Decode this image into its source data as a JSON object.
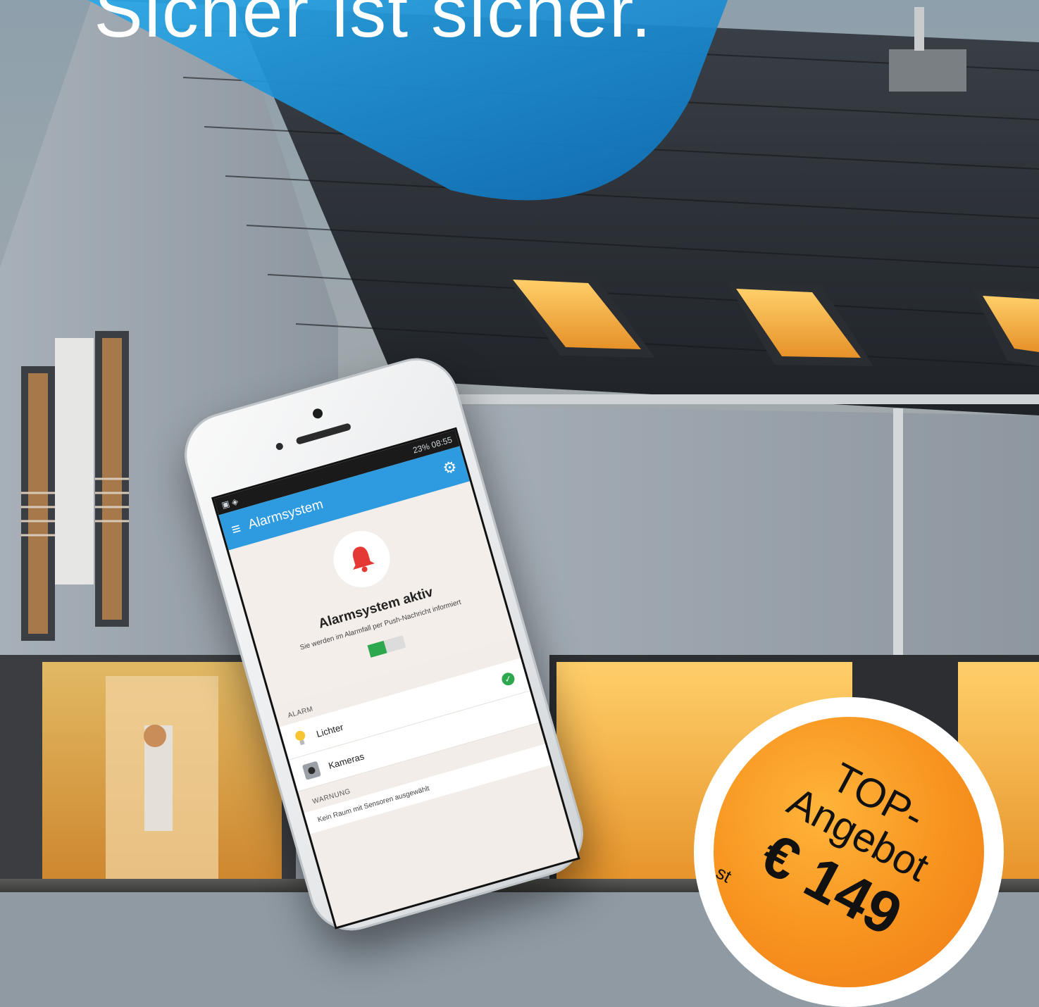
{
  "headline": "Sicher ist sicher.",
  "phone": {
    "status_right": "23% 08:55",
    "app_title": "Alarmsystem",
    "status_title": "Alarmsystem aktiv",
    "status_subtitle": "Sie werden im Alarmfall per Push-Nachricht informiert",
    "section_alarm": "ALARM",
    "rows": [
      {
        "label": "Lichter",
        "icon": "bulb-icon",
        "checked": true
      },
      {
        "label": "Kameras",
        "icon": "camera-icon",
        "checked": false
      }
    ],
    "section_warning": "WARNUNG",
    "warning_text": "Kein Raum mit Sensoren ausgewählt"
  },
  "badge": {
    "line1": "TOP-",
    "line2": "Angebot",
    "price": "€ 149",
    "small": "st"
  },
  "colors": {
    "appbar": "#2e9be0",
    "badge_orange": "#f7921e",
    "check_green": "#2ea84f",
    "bell_red": "#e53935"
  }
}
